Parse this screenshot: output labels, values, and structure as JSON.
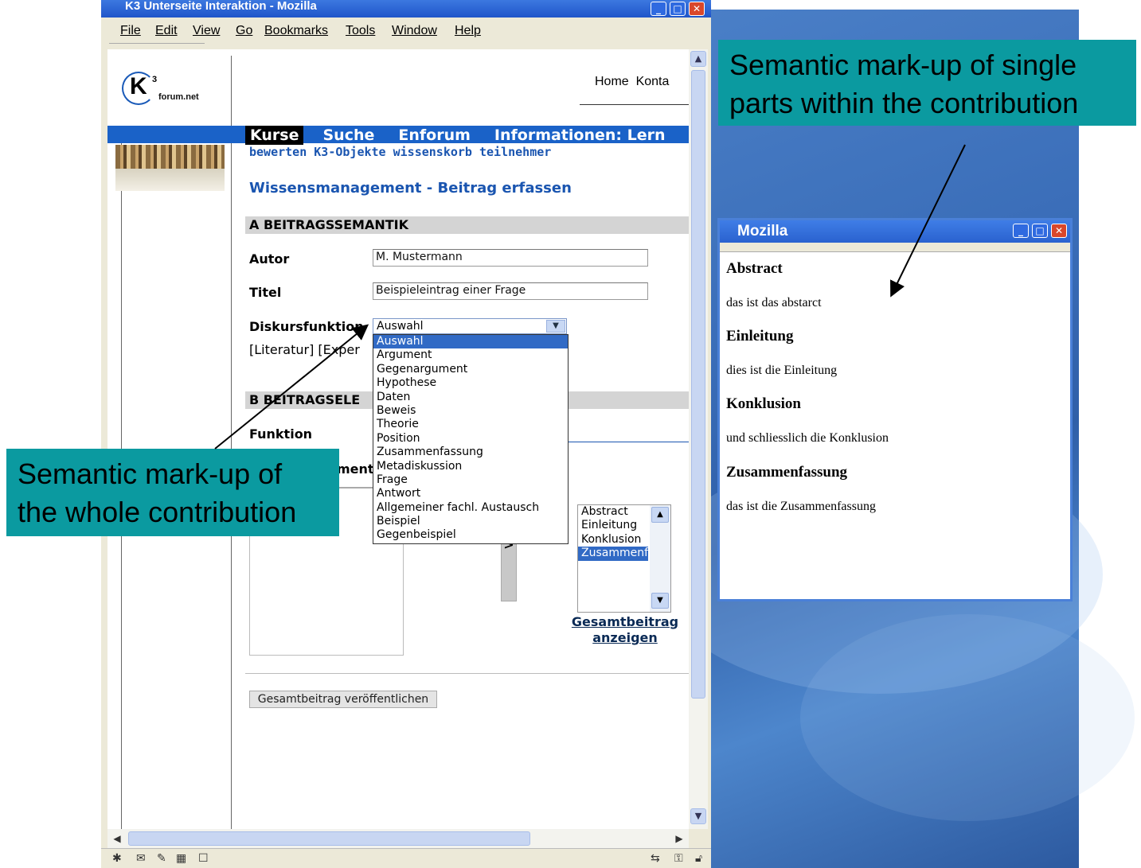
{
  "main_window": {
    "title": "K3 Unterseite Interaktion - Mozilla",
    "menu": [
      "File",
      "Edit",
      "View",
      "Go",
      "Bookmarks",
      "Tools",
      "Window",
      "Help"
    ]
  },
  "page": {
    "logo_superscript": "3",
    "logo_letter": "K",
    "logo_domain": "forum.net",
    "top_links": "Home  Konta",
    "nav_main": [
      "Kurse",
      "Suche",
      "Enforum",
      "Informationen: Lern"
    ],
    "nav_sub": "bewerten K3-Objekte wissenskorb teilnehmer",
    "heading": "Wissensmanagement - Beitrag erfassen",
    "section_a": "A BEITRAGSSEMANTIK",
    "autor_label": "Autor",
    "autor_value": "M. Mustermann",
    "titel_label": "Titel",
    "titel_value": "Beispieleintrag einer Frage",
    "diskurs_label": "Diskursfunktion",
    "diskurs_selected": "Auswahl",
    "diskurs_options": [
      "Auswahl",
      "Argument",
      "Gegenargument",
      "Hypothese",
      "Daten",
      "Beweis",
      "Theorie",
      "Position",
      "Zusammenfassung",
      "Metadiskussion",
      "Frage",
      "Antwort",
      "Allgemeiner fachl. Austausch",
      "Beispiel",
      "Gegenbeispiel"
    ],
    "refs": "[Literatur] [Exper",
    "section_b": "B BEITRAGSELE",
    "funktion_label": "Funktion",
    "partial_label": "ment",
    "arrow_label": ">",
    "parts": [
      "Abstract",
      "Einleitung",
      "Konklusion",
      "Zusammenf"
    ],
    "show_all_link": "Gesamtbeitrag anzeigen",
    "publish_button": "Gesamtbeitrag veröffentlichen"
  },
  "popup": {
    "title": "Mozilla",
    "sections": [
      {
        "heading": "Abstract",
        "text": "das ist das abstarct"
      },
      {
        "heading": "Einleitung",
        "text": "dies ist die Einleitung"
      },
      {
        "heading": "Konklusion",
        "text": "und schliesslich die Konklusion"
      },
      {
        "heading": "Zusammenfassung",
        "text": "das ist die Zusammenfassung"
      }
    ]
  },
  "callouts": {
    "right": "Semantic mark-up of single parts within the contribution",
    "left": "Semantic mark-up of the whole contribution"
  },
  "colors": {
    "callout_bg": "#0b9aa0",
    "link_blue": "#1a55b0",
    "selection_blue": "#316ac5",
    "desktop_blue": "#3a6db8"
  }
}
